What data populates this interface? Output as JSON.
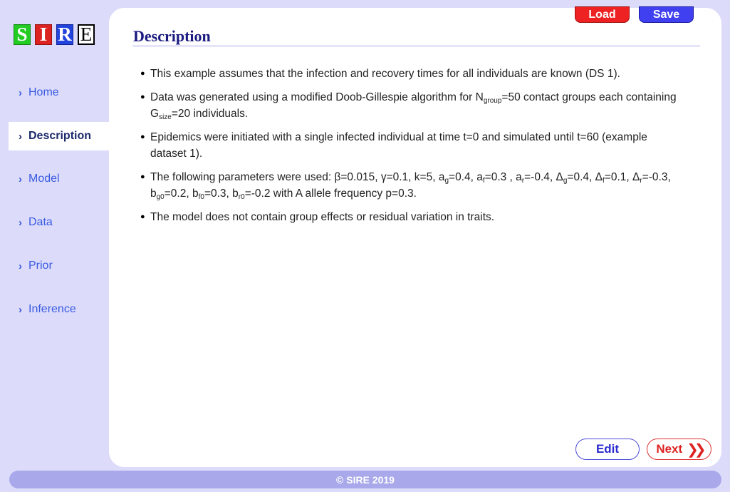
{
  "logo": {
    "letters": [
      "S",
      "I",
      "R",
      "E"
    ]
  },
  "sidebar": {
    "items": [
      {
        "label": "Home",
        "active": false
      },
      {
        "label": "Description",
        "active": true
      },
      {
        "label": "Model",
        "active": false
      },
      {
        "label": "Data",
        "active": false
      },
      {
        "label": "Prior",
        "active": false
      },
      {
        "label": "Inference",
        "active": false
      }
    ],
    "chevron": "›"
  },
  "toolbar": {
    "load_label": "Load",
    "save_label": "Save"
  },
  "page": {
    "title": "Description",
    "bullets": [
      "This example assumes that the infection and recovery times for all individuals are known (DS 1).",
      "Data was generated using a modified Doob-Gillespie algorithm for N_group=50 contact groups each containing G_size=20 individuals.",
      "Epidemics were initiated with a single infected individual at time t=0 and simulated until t=60 (example dataset 1).",
      "The following parameters were used: β=0.015, γ=0.1, k=5, a_g=0.4, a_f=0.3 , a_r=-0.4, Δ_g=0.4, Δ_f=0.1, Δ_r=-0.3, b_g0=0.2, b_f0=0.3, b_r0=-0.2 with A allele frequency p=0.3.",
      "The model does not contain group effects or residual variation in traits."
    ]
  },
  "nav": {
    "edit_label": "Edit",
    "next_label": "Next",
    "next_icon": "double-chevron-right"
  },
  "footer": {
    "text": "© SIRE 2019"
  },
  "colors": {
    "background": "#dcdcfa",
    "load": "#ee2222",
    "save": "#4040f0",
    "sidebar_link": "#3a5ae0",
    "title": "#1a1a80",
    "footer": "#a8a8ea"
  }
}
